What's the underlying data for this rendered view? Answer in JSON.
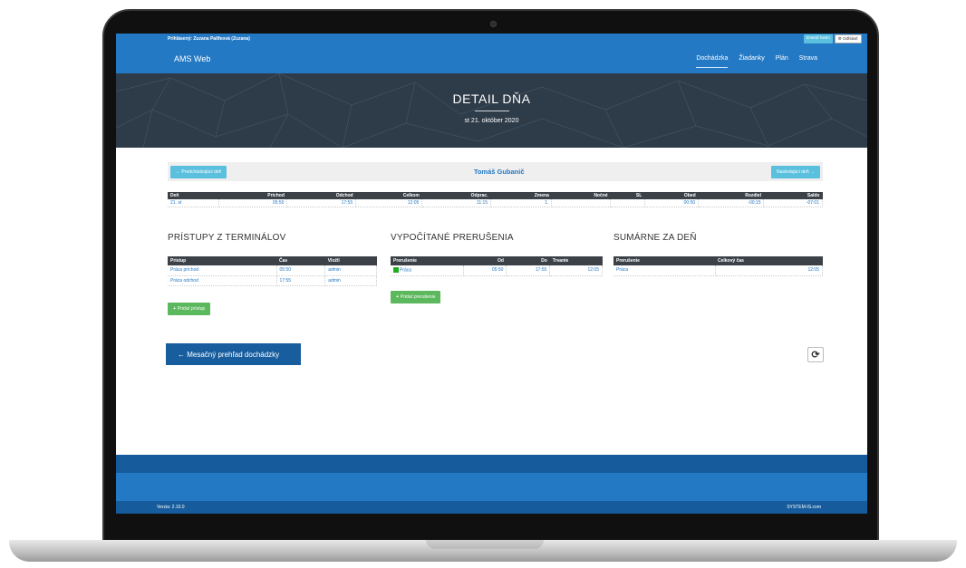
{
  "topbar": {
    "logged_user": "Prihlásený: Zuzana Pallfeová (Zuzana)",
    "change_password": "Zmeniť heslo",
    "logout": "Odhlásiť"
  },
  "navbar": {
    "brand": "AMS Web",
    "items": [
      {
        "label": "Dochádzka",
        "active": true
      },
      {
        "label": "Žiadanky",
        "active": false
      },
      {
        "label": "Plán",
        "active": false
      },
      {
        "label": "Strava",
        "active": false
      }
    ]
  },
  "hero": {
    "title": "DETAIL DŇA",
    "date": "st 21. október 2020"
  },
  "employee_bar": {
    "prev_label": "← Predchádzajúci deň",
    "name": "Tomáš Gubanič",
    "next_label": "Nasledujúci deň →"
  },
  "main_table": {
    "headers": [
      "Deň",
      "Príchod",
      "Odchod",
      "Celkom",
      "Odprac.",
      "Zmena",
      "Nočné",
      "SL",
      "Obed",
      "Rozdiel",
      "Saldo"
    ],
    "row": [
      "21. st",
      "05:50",
      "17:55",
      "12:05",
      "11:15",
      "1.",
      "",
      "",
      "00:50",
      "-00:15",
      "-07:01"
    ]
  },
  "pristupy": {
    "title": "PRÍSTUPY Z TERMINÁLOV",
    "headers": [
      "Prístup",
      "Čas",
      "Vložil"
    ],
    "rows": [
      [
        "Práca príchod",
        "05:50",
        "admin"
      ],
      [
        "Práca odchod",
        "17:55",
        "admin"
      ]
    ],
    "add_label": "Pridať prístup",
    "add_icon": "plus-icon"
  },
  "prerusenia": {
    "title": "VYPOČÍTANÉ PRERUŠENIA",
    "headers": [
      "Prerušenie",
      "Od",
      "Do",
      "Trvanie"
    ],
    "rows": [
      [
        "Práca",
        "05:50",
        "17:55",
        "12:05"
      ]
    ],
    "row_marker_color": "#22aa22",
    "add_label": "Pridať prerušenie",
    "add_icon": "plus-icon"
  },
  "sumarne": {
    "title": "SUMÁRNE ZA DEŇ",
    "headers": [
      "Prerušenie",
      "Celkový čas"
    ],
    "rows": [
      [
        "Práca",
        "12:05"
      ]
    ]
  },
  "actions": {
    "monthly_label": "← Mesačný prehľad dochádzky",
    "refresh_icon": "refresh-icon"
  },
  "footer": {
    "version": "Verzia: 2.10.0",
    "company": "SYSTEM-IS.com"
  },
  "colors": {
    "primary": "#2479c4",
    "dark_primary": "#165c9c",
    "info": "#5bc0de",
    "success": "#5cb85c",
    "table_header": "#3c4148"
  }
}
